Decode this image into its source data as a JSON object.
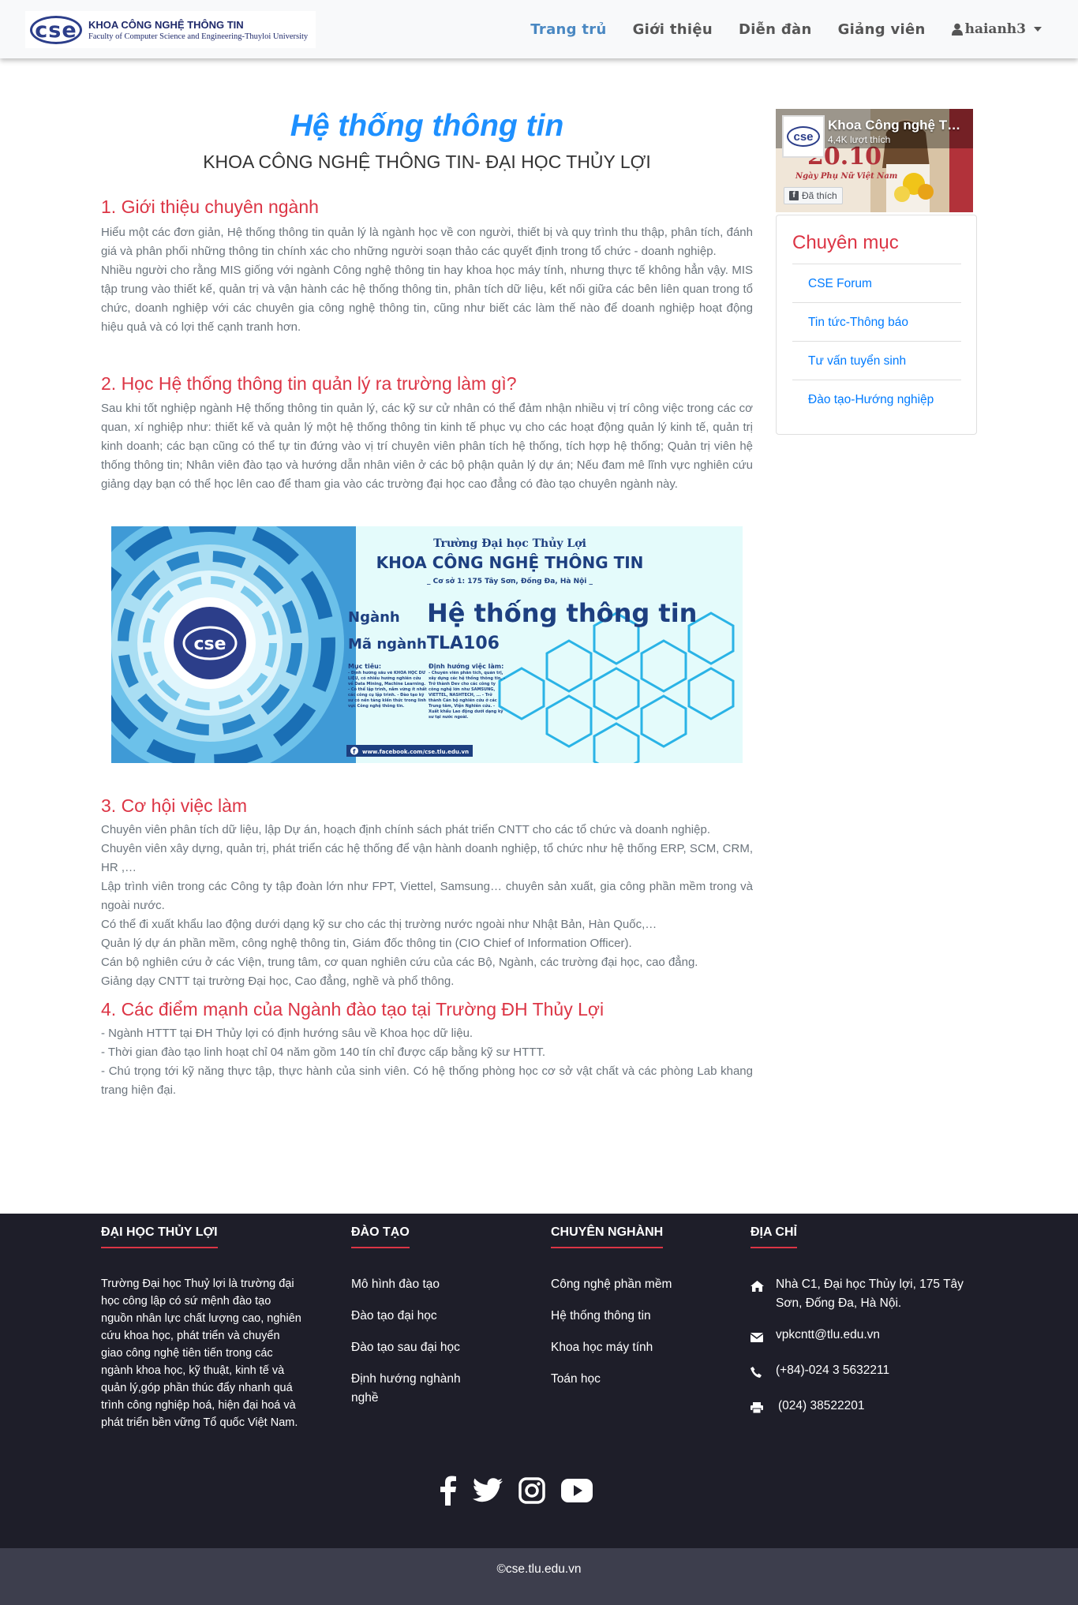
{
  "navbar": {
    "logo_title": "KHOA CÔNG NGHỆ THÔNG TIN",
    "logo_subtitle": "Faculty of Computer Science and Engineering-Thuyloi University",
    "logo_mark": "cse",
    "items": [
      {
        "label": "Trang trủ",
        "active": true
      },
      {
        "label": "Giới thiệu"
      },
      {
        "label": "Diễn đàn"
      },
      {
        "label": "Giảng viên"
      }
    ],
    "user": "haianh3",
    "user_icon": "user-icon"
  },
  "main": {
    "title": "Hệ thống thông tin",
    "subtitle": "KHOA CÔNG NGHỆ THÔNG TIN- ĐẠI HỌC THỦY LỢI",
    "sections": [
      {
        "title": "1. Giới thiệu chuyên ngành",
        "paragraphs": [
          "Hiểu một các đơn giản, Hệ thống thông tin quản lý là ngành học về con người, thiết bị và quy trình thu thập, phân tích, đánh giá và phân phối những thông tin chính xác cho những người soạn thảo các quyết định trong tổ chức - doanh nghiệp.",
          "Nhiều người cho rằng MIS giống với ngành Công nghệ thông tin hay khoa học máy tính, nhưng thực tế không hẳn vậy. MIS tập trung vào thiết kế, quản trị và vận hành các hệ thống thông tin, phân tích dữ liệu, kết nối giữa các bên liên quan trong tổ chức, doanh nghiệp với các chuyên gia công nghệ thông tin, cũng như biết các làm thế nào để doanh nghiệp hoạt động hiệu quả và có lợi thế cạnh tranh hơn."
        ]
      },
      {
        "title": "2. Học Hệ thống thông tin quản lý ra trường làm gì?",
        "paragraphs": [
          "Sau khi tốt nghiệp ngành Hệ thống thông tin quản lý, các kỹ sư cử nhân có thể đảm nhận nhiều vị trí công việc trong các cơ quan, xí nghiệp như: thiết kế và quản lý một hệ thống thông tin kinh tế phục vụ cho các hoạt động quản lý kinh tế, quản trị kinh doanh; các bạn cũng có thể tự tin đứng vào vị trí chuyên viên phân tích hệ thống, tích hợp hệ thống; Quản trị viên hệ thống thông tin; Nhân viên đào tạo và hướng dẫn nhân viên ở các bộ phận quản lý dự án; Nếu đam mê lĩnh vực nghiên cứu giảng dạy bạn có thể học lên cao để tham gia vào các trường đại học cao đẳng có đào tạo chuyên ngành này."
        ]
      },
      {
        "title": "3. Cơ hội việc làm",
        "paragraphs": [
          "Chuyên viên phân tích dữ liệu, lập Dự án, hoạch định chính sách phát triển CNTT cho các tổ chức và doanh nghiệp.",
          "Chuyên viên xây dựng, quản trị, phát triển các hệ thống để vận hành doanh nghiệp, tổ chức như hệ thống ERP, SCM, CRM, HR ,…",
          "Lập trình viên trong các Công ty tập đoàn lớn như FPT, Viettel, Samsung… chuyên sản xuất, gia công phần mềm trong và ngoài nước.",
          "Có thể đi xuất khẩu lao động dưới dạng kỹ sư cho các thị trường nước ngoài như Nhật Bản, Hàn Quốc,…",
          "Quản lý dự án phần mềm, công nghệ thông tin, Giám đốc thông tin (CIO Chief of Information Officer).",
          "Cán bộ nghiên cứu ở các Viện, trung tâm, cơ quan nghiên cứu của các Bộ, Ngành, các trường đại học, cao đẳng.",
          "Giảng dạy CNTT tại trường Đại học, Cao đẳng, nghề và phổ thông."
        ]
      },
      {
        "title": "4. Các điểm mạnh của Ngành đào tạo tại Trường ĐH Thủy Lợi",
        "paragraphs": [
          "- Ngành HTTT tại ĐH Thủy lợi có định hướng sâu về Khoa học dữ liệu.",
          "- Thời gian đào tạo linh hoạt chỉ 04 năm gồm 140 tín chỉ được cấp bằng kỹ sư HTTT.",
          "- Chú trọng tới kỹ năng thực tập, thực hành của sinh viên. Có hệ thống phòng học cơ sở vật chất và các phòng Lab khang trang hiện đại."
        ]
      }
    ],
    "banner": {
      "school": "Trường Đại học Thủy Lợi",
      "faculty": "KHOA CÔNG NGHỆ THÔNG TIN",
      "campus": "_ Cơ sở 1: 175 Tây Sơn, Đống Đa, Hà Nội _",
      "major_label": "Ngành",
      "major": "Hệ thống thông tin",
      "code_label": "Mã ngành",
      "code": "TLA106",
      "goal_title": "Mục tiêu:",
      "goals": "- Định hướng sâu về KHOA HỌC DỮ LIỆU, có nhiều hướng nghiên cứu về Data Mining, Machine Learning. - Có thể lập trình, nắm vững ít nhất các công cụ lập trình. - Đào tạo kỹ sư có nền tảng kiến thức trong lĩnh vực Công nghệ thông tin.",
      "career_title": "Định hướng việc làm:",
      "careers": "- Chuyên viên phân tích, quản trị, xây dựng các hệ thống thông tin. - Trở thành Dev cho các công ty công nghệ lớn như SAMSUNG, VIETTEL, NASHTECH, ... - Trở thành Cán bộ nghiên cứu ở các Trung tâm, Viện Nghiên cứu. - Xuất khẩu Lao động dưới dạng kỹ sư tại nước ngoài.",
      "facebook": "www.facebook.com/cse.tlu.edu.vn",
      "logo_text": "cse"
    }
  },
  "sidebar": {
    "fb": {
      "name": "Khoa Công nghệ Thông tin",
      "likes": "4,4K lượt thích",
      "button": "Đã thích",
      "poster_caption": "Ngày Phụ Nữ Việt Nam",
      "poster_date": "20.10",
      "logo_text": "cse"
    },
    "category_title": "Chuyên mục",
    "categories": [
      "CSE Forum",
      "Tin tức-Thông báo",
      "Tư vấn tuyển sinh",
      "Đào tạo-Hướng nghiệp"
    ]
  },
  "footer": {
    "about_title": "ĐẠI HỌC THỦY LỢI",
    "about_text": "Trường Đại học Thuỷ lợi là trường đại học công lập có sứ mệnh đào tạo nguồn nhân lực chất lượng cao, nghiên cứu khoa học, phát triển và chuyển giao công nghệ tiên tiến trong các ngành khoa học, kỹ thuật, kinh tế và quản lý,góp phần thúc đẩy nhanh quá trình công nghiệp hoá, hiện đại hoá và phát triển bền vững Tổ quốc Việt Nam.",
    "training_title": "ĐÀO TẠO",
    "training_links": [
      "Mô hình đào tạo",
      "Đào tạo đại học",
      "Đào tạo sau đại học",
      "Định hướng nghành nghề"
    ],
    "majors_title": "CHUYÊN NGHÀNH",
    "major_links": [
      "Công nghệ phần mềm",
      "Hệ thống thông tin",
      "Khoa học máy tính",
      "Toán học"
    ],
    "address_title": "ĐỊA CHỈ",
    "address": "Nhà C1, Đại học Thủy lợi, 175 Tây Sơn, Đống Đa, Hà Nội.",
    "email": "vpkcntt@tlu.edu.vn",
    "phone": "(+84)-024 3 5632211",
    "fax": "(024) 38522201",
    "social": [
      "facebook-icon",
      "twitter-icon",
      "instagram-icon",
      "youtube-icon"
    ],
    "copyright": "©cse.tlu.edu.vn"
  },
  "colors": {
    "accent": "#1e90ff",
    "section_title": "#dc3545",
    "nav_active": "#4a88c2",
    "footer_bg": "#1e1e29",
    "copyright_bg": "#3d3e4d"
  }
}
